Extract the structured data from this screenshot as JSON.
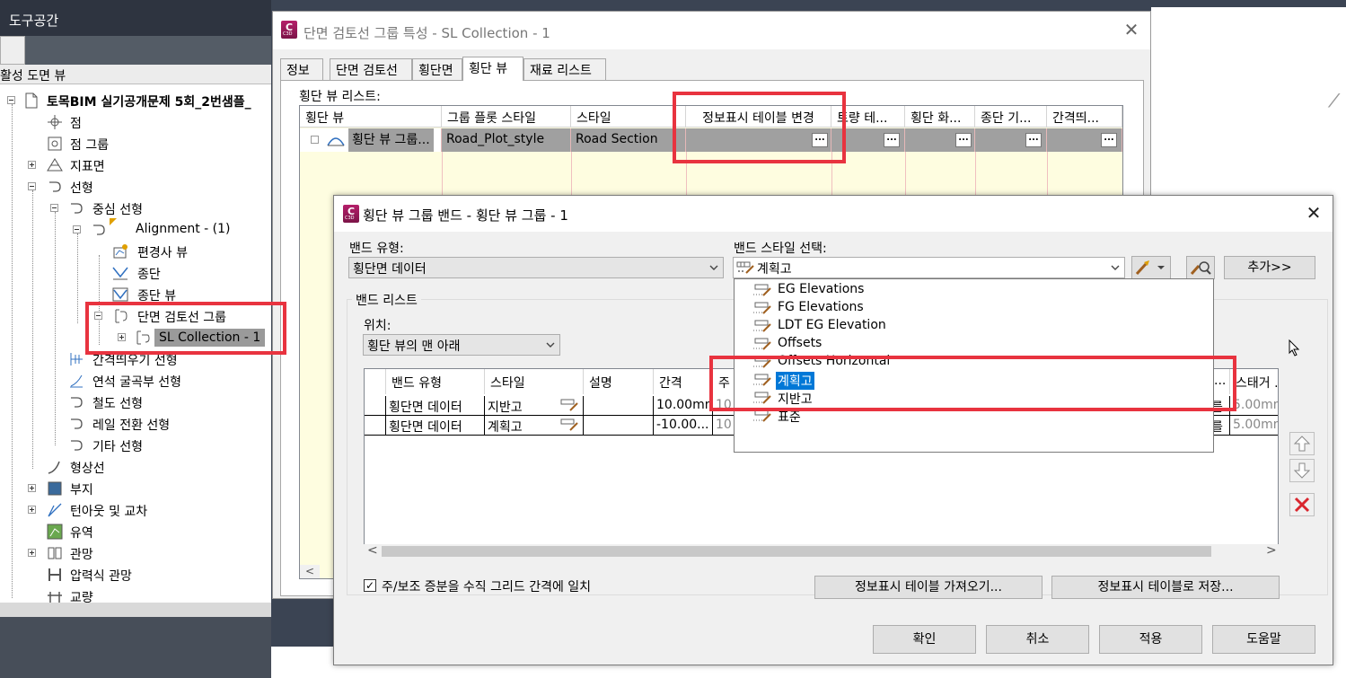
{
  "toolspace": {
    "title": "도구공간",
    "view_combo": "활성 도면 뷰",
    "tree": [
      {
        "label": "토목BIM 실기공개문제 5회_2번샘플_",
        "level": 0
      },
      {
        "label": "점",
        "level": 1
      },
      {
        "label": "점 그룹",
        "level": 1
      },
      {
        "label": "지표면",
        "level": 1
      },
      {
        "label": "선형",
        "level": 1
      },
      {
        "label": "중심 선형",
        "level": 2
      },
      {
        "label": "Alignment - (1)",
        "level": 3
      },
      {
        "label": "편경사 뷰",
        "level": 4
      },
      {
        "label": "종단",
        "level": 4
      },
      {
        "label": "종단 뷰",
        "level": 4
      },
      {
        "label": "단면 검토선 그룹",
        "level": 4
      },
      {
        "label": "SL Collection - 1",
        "level": 5
      },
      {
        "label": "간격띄우기 선형",
        "level": 2
      },
      {
        "label": "연석 굴곡부 선형",
        "level": 2
      },
      {
        "label": "철도 선형",
        "level": 2
      },
      {
        "label": "레일 전환 선형",
        "level": 2
      },
      {
        "label": "기타 선형",
        "level": 2
      },
      {
        "label": "형상선",
        "level": 1
      },
      {
        "label": "부지",
        "level": 1
      },
      {
        "label": "턴아웃 및 교차",
        "level": 1
      },
      {
        "label": "유역",
        "level": 1
      },
      {
        "label": "관망",
        "level": 1
      },
      {
        "label": "압력식 관망",
        "level": 1
      },
      {
        "label": "교량",
        "level": 1
      }
    ]
  },
  "dialog1": {
    "title": "단면 검토선 그룹 특성 - SL Collection - 1",
    "tabs": [
      "정보",
      "단면 검토선",
      "횡단면",
      "횡단 뷰",
      "재료 리스트"
    ],
    "active_tab": "횡단 뷰",
    "list_label": "횡단 뷰 리스트:",
    "columns": [
      "횡단 뷰",
      "그룹 플롯 스타일",
      "스타일",
      "정보표시 테이블 변경",
      "토량 테...",
      "횡단 화...",
      "종단 기...",
      "간격띄..."
    ],
    "row": {
      "name": "횡단 뷰 그룹...",
      "plot_style": "Road_Plot_style",
      "style": "Road Section",
      "dots": "..."
    }
  },
  "dialog2": {
    "title": "횡단 뷰 그룹 밴드 - 횡단 뷰 그룹 - 1",
    "band_type_label": "밴드 유형:",
    "band_type_value": "횡단면 데이터",
    "band_style_label": "밴드 스타일 선택:",
    "band_style_value": "계획고",
    "add_button": "추가>>",
    "band_list_label": "밴드 리스트",
    "position_label": "위치:",
    "position_value": "횡단 뷰의 맨 아래",
    "columns": [
      "밴드 유형",
      "스타일",
      "설명",
      "간격",
      "주",
      "...",
      "스태거 ..."
    ],
    "rows": [
      {
        "type": "횡단면 데이터",
        "style": "지반고",
        "interval": "10.00mm",
        "major": "10",
        "extra": "를",
        "stagger": "5.00mm"
      },
      {
        "type": "횡단면 데이터",
        "style": "계획고",
        "interval": "-10.00...",
        "major": "10",
        "extra": "를",
        "stagger": "5.00mm"
      }
    ],
    "dropdown_items": [
      "EG Elevations",
      "FG Elevations",
      "LDT EG Elevation",
      "Offsets",
      "Offsets Horizontal",
      "계획고",
      "지반고",
      "표준"
    ],
    "highlighted_item": "계획고",
    "checkbox_label": "주/보조 증분을 수직 그리드 간격에 일치",
    "checkbox_checked": true,
    "import_button": "정보표시 테이블 가져오기...",
    "save_button": "정보표시 테이블로 저장...",
    "ok": "확인",
    "cancel": "취소",
    "apply": "적용",
    "help": "도움말"
  },
  "colors": {
    "highlight_red": "#e8333f",
    "selection_blue": "#0078d7",
    "grid_background": "#fefde0",
    "app_icon": "#a01a5c"
  }
}
